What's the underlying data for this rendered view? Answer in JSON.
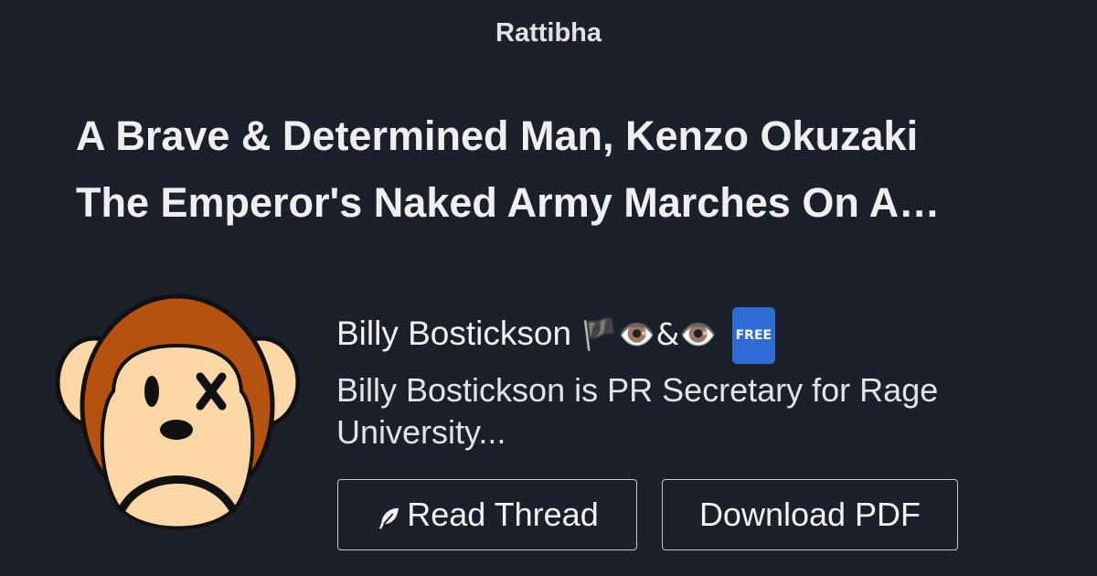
{
  "brand": "Rattibha",
  "title": {
    "line1": "A Brave & Determined Man, Kenzo Okuzaki",
    "line2": "The Emperor's Naked Army Marches On A…"
  },
  "author": {
    "name": "Billy Bostickson",
    "emoji": "🏴👁️&👁️",
    "badge": "FREE"
  },
  "bio": "Billy Bostickson is PR Secretary for Rage University...",
  "buttons": {
    "read": "Read Thread",
    "download": "Download PDF"
  },
  "icons": {
    "avatar": "sad-monkey-avatar",
    "read": "feather-icon"
  },
  "colors": {
    "background": "#1b202b",
    "monkey_fur": "#b5520f",
    "monkey_face": "#fbd7a6",
    "badge": "#2f6bd4"
  }
}
